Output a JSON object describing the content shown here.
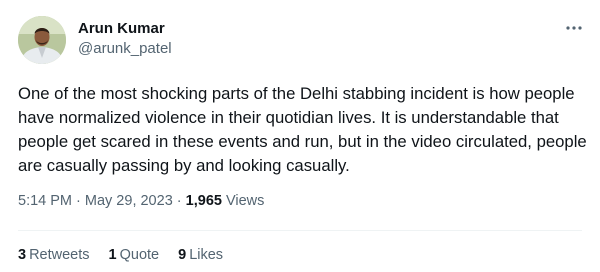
{
  "author": {
    "name": "Arun Kumar",
    "handle": "@arunk_patel"
  },
  "tweet": {
    "text": "One of the most shocking parts of the Delhi stabbing incident is how people have normalized violence in their quotidian lives. It is understandable that people get scared in these events and run, but in the video circulated, people are casually passing by and looking casually.",
    "time": "5:14 PM",
    "date": "May 29, 2023",
    "views_count": "1,965",
    "views_label": "Views"
  },
  "stats": {
    "retweets_count": "3",
    "retweets_label": "Retweets",
    "quotes_count": "1",
    "quotes_label": "Quote",
    "likes_count": "9",
    "likes_label": "Likes"
  },
  "icons": {
    "more": "more-options-icon",
    "avatar": "profile-photo"
  },
  "colors": {
    "primary_text": "#0f1419",
    "secondary_text": "#536471",
    "divider": "#eff3f4"
  }
}
